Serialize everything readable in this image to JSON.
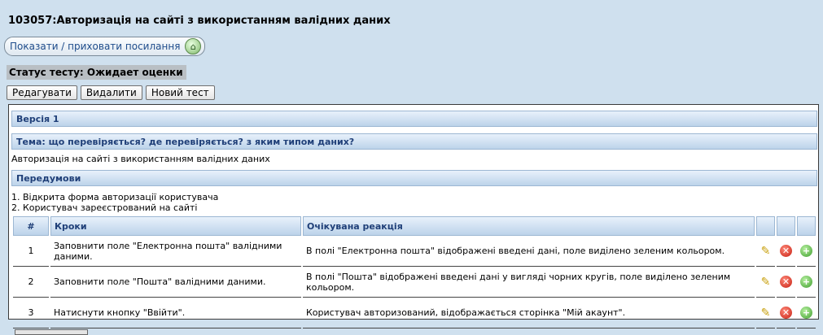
{
  "page": {
    "title": "103057:Авторизація на сайті з використанням валідних даних",
    "toggle_links_label": "Показати / приховати посилання",
    "status_text": "Статус тесту: Ожидает оценки"
  },
  "actions": {
    "edit": "Редагувати",
    "delete": "Видалити",
    "new_test": "Новий тест"
  },
  "test": {
    "version_header": "Версія 1",
    "topic_header": "Тема: що перевіряється? де перевіряється? з яким типом даних?",
    "topic_text": "Авторизація на сайті з використанням валідних даних",
    "preconditions_header": "Передумови",
    "preconditions": [
      "1. Відкрита форма авторизації користувача",
      "2. Користувач зареєстрований на сайті"
    ],
    "columns": {
      "num": "#",
      "steps": "Кроки",
      "expected": "Очікувана реакція"
    },
    "steps": [
      {
        "num": "1",
        "step": "Заповнити поле \"Електронна пошта\" валідними даними.",
        "expected": "В полі \"Електронна пошта\" відображені введені дані, поле виділено зеленим кольором."
      },
      {
        "num": "2",
        "step": "Заповнити поле \"Пошта\" валідними даними.",
        "expected": "В полі \"Пошта\" відображені введені дані у вигляді чорних кругів, поле виділено зеленим кольором."
      },
      {
        "num": "3",
        "step": "Натиснути кнопку \"Ввійти\".",
        "expected": "Користувач авторизований, відображається сторінка \"Мій акаунт\"."
      }
    ]
  }
}
